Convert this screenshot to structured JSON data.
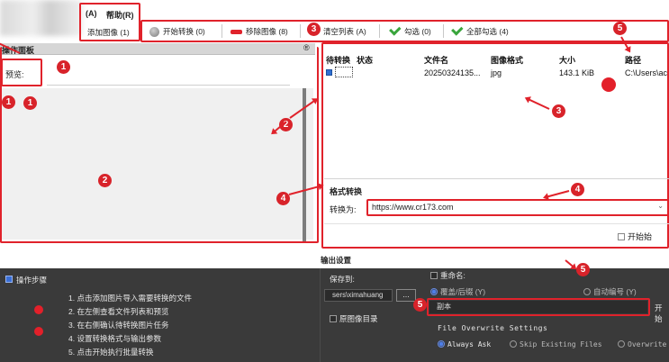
{
  "menu": {
    "item1": "(A)",
    "help": "帮助(R)"
  },
  "toolbar": {
    "add_image": "添加图像 (1)",
    "start_convert": "开始转换 (0)",
    "remove_image": "移除图像 (8)",
    "clear_list": "清空列表 (A)",
    "check": "勾选 (0)",
    "check_all": "全部勾选 (4)"
  },
  "left_panel": {
    "title": "操作面板",
    "pin": "®",
    "preview_label": "预览:"
  },
  "file_table": {
    "headers": [
      "待转换",
      "状态",
      "文件名",
      "图像格式",
      "大小",
      "路径"
    ],
    "rows": [
      {
        "status": "",
        "filename": "20250324135...",
        "format": "jpg",
        "size": "143.1 KiB",
        "path": "C:\\Users\\ac"
      }
    ]
  },
  "format_section": {
    "title": "格式转换",
    "convert_label": "转换为:",
    "convert_value": "https://www.cr173.com",
    "start_checkbox": "开始始"
  },
  "steps": {
    "title": "操作步骤",
    "items": [
      "1. 点击添加图片导入需要转换的文件",
      "2. 在左侧查看文件列表和预览",
      "3. 在右侧确认待转换图片任务",
      "4. 设置转换格式与输出参数",
      "5. 点击开始执行批量转换"
    ]
  },
  "output_settings": {
    "title": "输出设置",
    "save_to": "保存到:",
    "path_value": "sers\\ximahuang",
    "browse": "...",
    "rename": "重命名:",
    "overwrite_suffix": "覆盖/后缀 (Y)",
    "auto_number": "自动编号 (Y)",
    "source_dir": "原图像目录",
    "suffix_value": "副本",
    "start_short": "开始",
    "file_overwrite": "File Overwrite Settings",
    "always_ask": "Always Ask",
    "skip_existing": "Skip Existing Files",
    "overwrite": "Overwrite"
  },
  "badges": {
    "one": "1",
    "two": "2",
    "three": "3",
    "four": "4",
    "five": "5"
  },
  "colors": {
    "accent_red": "#e0222b",
    "check_green": "#3aa53c",
    "dark_panel": "#3a3a3a"
  }
}
